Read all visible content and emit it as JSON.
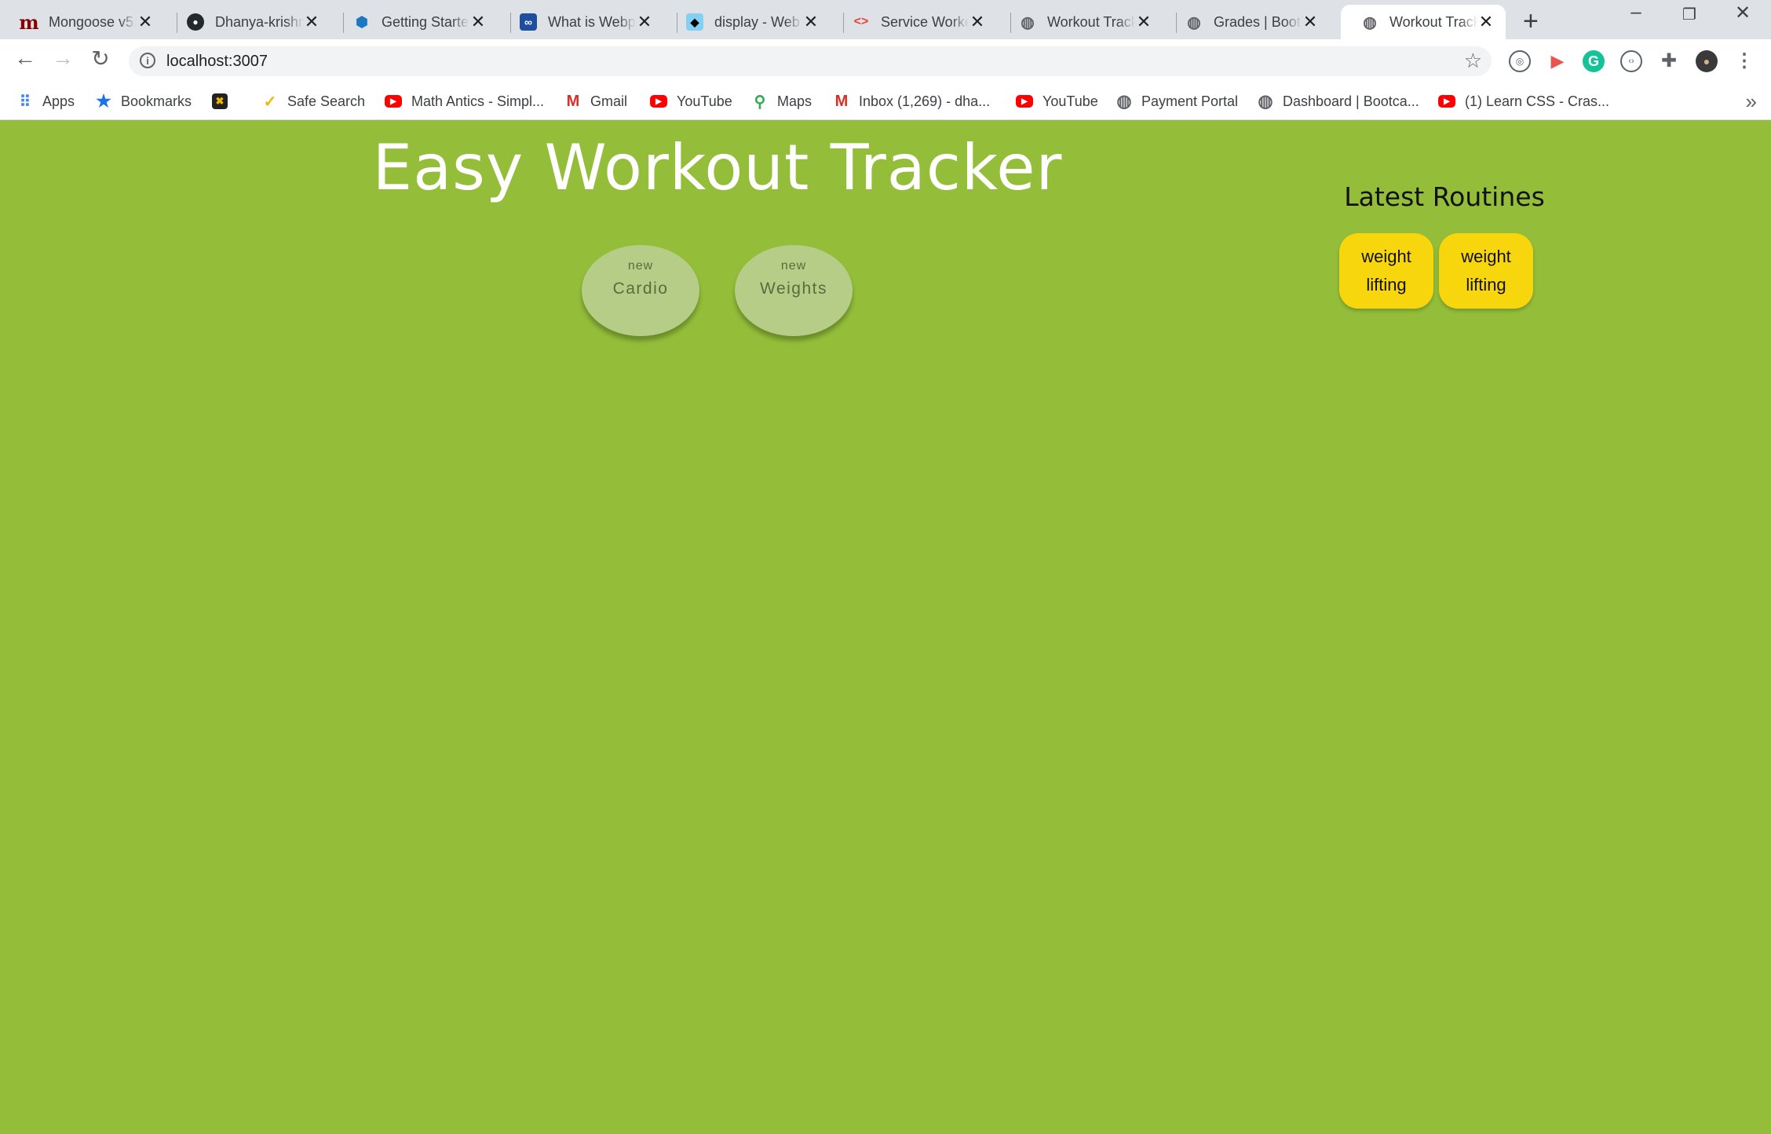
{
  "browser": {
    "tabs": [
      {
        "title": "Mongoose v5.",
        "icon": "mongoose-icon"
      },
      {
        "title": "Dhanya-krishn",
        "icon": "github-icon"
      },
      {
        "title": "Getting Startec",
        "icon": "webpack-icon"
      },
      {
        "title": "What is Webp",
        "icon": "codeinfinity-icon"
      },
      {
        "title": "display - Web",
        "icon": "mdn-icon"
      },
      {
        "title": "Service Worke",
        "icon": "google-dev-icon"
      },
      {
        "title": "Workout Track",
        "icon": "globe-icon"
      },
      {
        "title": "Grades | Bootc",
        "icon": "globe-icon"
      },
      {
        "title": "Workout Track",
        "icon": "globe-icon",
        "active": true
      }
    ],
    "url": "localhost:3007",
    "bookmarks": [
      {
        "label": "Apps",
        "icon": "apps-grid-icon"
      },
      {
        "label": "Bookmarks",
        "icon": "star-icon"
      },
      {
        "label": "",
        "icon": "colorful-app-icon"
      },
      {
        "label": "Safe Search",
        "icon": "safe-search-icon"
      },
      {
        "label": "Math Antics - Simpl...",
        "icon": "youtube-icon"
      },
      {
        "label": "Gmail",
        "icon": "gmail-icon"
      },
      {
        "label": "YouTube",
        "icon": "youtube-icon"
      },
      {
        "label": "Maps",
        "icon": "maps-icon"
      },
      {
        "label": "Inbox (1,269) - dha...",
        "icon": "gmail-icon"
      },
      {
        "label": "YouTube",
        "icon": "youtube-icon"
      },
      {
        "label": "Payment Portal",
        "icon": "globe-icon"
      },
      {
        "label": "Dashboard | Bootca...",
        "icon": "globe-icon"
      },
      {
        "label": "(1) Learn CSS - Cras...",
        "icon": "youtube-icon"
      }
    ]
  },
  "app": {
    "title": "Easy Workout Tracker",
    "new_buttons": [
      {
        "small": "new",
        "label": "Cardio"
      },
      {
        "small": "new",
        "label": "Weights"
      }
    ],
    "routines": {
      "heading": "Latest Routines",
      "items": [
        "weight lifting",
        "weight lifting"
      ]
    },
    "colors": {
      "background": "#94be3a",
      "new_button": "#b5cd86",
      "routine_card": "#f8d60d",
      "title_text": "#ffffff"
    }
  }
}
